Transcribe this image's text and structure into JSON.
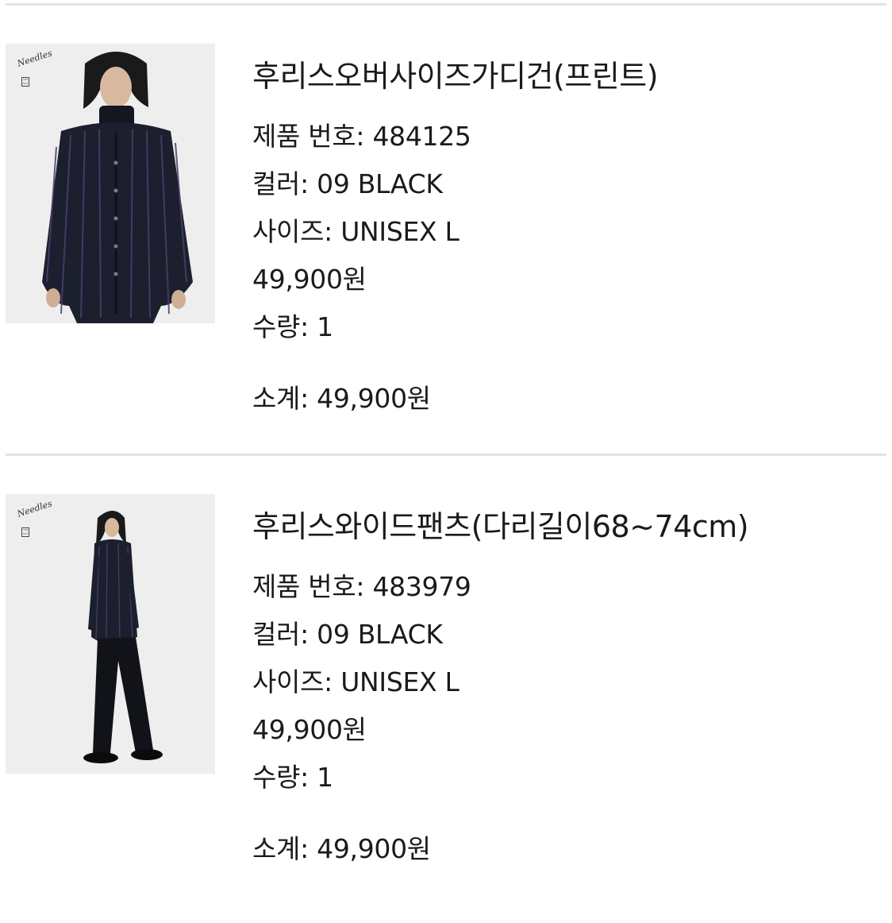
{
  "cart": {
    "items": [
      {
        "name": "후리스오버사이즈가디건(프린트)",
        "product_no": "제품 번호: 484125",
        "color": "컬러: 09 BLACK",
        "size": "사이즈: UNISEX L",
        "price": "49,900원",
        "quantity": "수량: 1",
        "subtotal": "소계: 49,900원",
        "image_icon": "cardigan-product-photo"
      },
      {
        "name": "후리스와이드팬츠(다리길이68~74cm)",
        "product_no": "제품 번호: 483979",
        "color": "컬러: 09 BLACK",
        "size": "사이즈: UNISEX L",
        "price": "49,900원",
        "quantity": "수량: 1",
        "subtotal": "소계: 49,900원",
        "image_icon": "wide-pants-product-photo"
      }
    ]
  },
  "colors": {
    "divider": "#e3e3e3",
    "text": "#1a1a1a",
    "photo_bg": "#eeeeee",
    "garment": "#1c1f2e"
  }
}
